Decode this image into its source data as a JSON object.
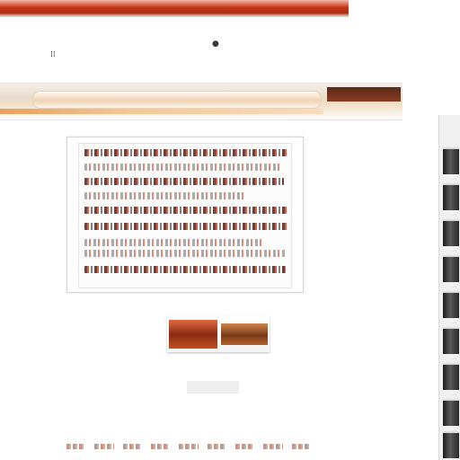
{
  "window": {
    "title_bar_color": "#b83414"
  },
  "toolbar": {
    "label": "",
    "sub_label": ""
  },
  "dialog": {
    "line_count": 9
  },
  "dialog_button": {
    "label": ""
  },
  "page_indicator": {
    "label": ""
  },
  "footer": {
    "link_count": 9
  },
  "colors": {
    "accent": "#c83818",
    "toolbar_ribbon": "#e8a060",
    "scroll_slot": "#2a2a2a"
  }
}
